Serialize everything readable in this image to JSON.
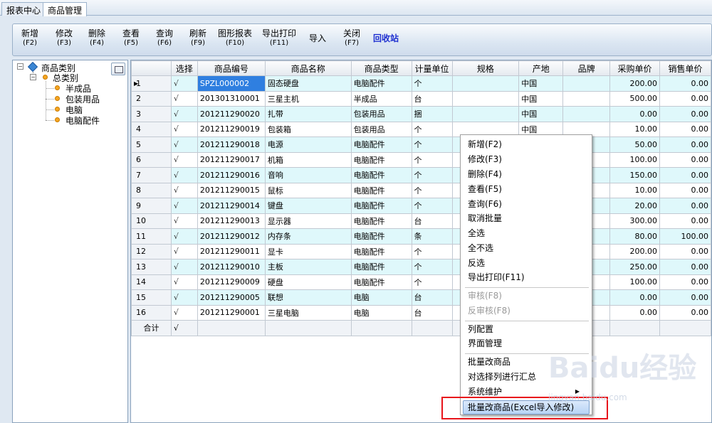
{
  "tabs": [
    "报表中心",
    "商品管理"
  ],
  "toolbar": {
    "buttons": [
      {
        "label": "新增",
        "key": "(F2)"
      },
      {
        "label": "修改",
        "key": "(F3)"
      },
      {
        "label": "删除",
        "key": "(F4)"
      },
      {
        "label": "查看",
        "key": "(F5)"
      },
      {
        "label": "查询",
        "key": "(F6)"
      },
      {
        "label": "刷新",
        "key": "(F9)"
      },
      {
        "label": "图形报表",
        "key": "(F10)"
      },
      {
        "label": "导出打印",
        "key": "(F11)"
      },
      {
        "label": "导入",
        "key": ""
      },
      {
        "label": "关闭",
        "key": "(F7)"
      },
      {
        "label": "回收站",
        "key": ""
      }
    ]
  },
  "tree": {
    "root": "商品类别",
    "group": "总类别",
    "children": [
      "半成品",
      "包装用品",
      "电脑",
      "电脑配件"
    ]
  },
  "grid": {
    "columns": [
      "选择",
      "商品编号",
      "商品名称",
      "商品类型",
      "计量单位",
      "规格",
      "产地",
      "品牌",
      "采购单价",
      "销售单价"
    ],
    "rows": [
      [
        "1",
        "√",
        "SPZL000002",
        "固态硬盘",
        "电脑配件",
        "个",
        "",
        "中国",
        "",
        "200.00",
        "0.00"
      ],
      [
        "2",
        "√",
        "201301310001",
        "三星主机",
        "半成品",
        "台",
        "",
        "中国",
        "",
        "500.00",
        "0.00"
      ],
      [
        "3",
        "√",
        "201211290020",
        "扎带",
        "包装用品",
        "捆",
        "",
        "中国",
        "",
        "0.00",
        "0.00"
      ],
      [
        "4",
        "√",
        "201211290019",
        "包装箱",
        "包装用品",
        "个",
        "",
        "中国",
        "",
        "10.00",
        "0.00"
      ],
      [
        "5",
        "√",
        "201211290018",
        "电源",
        "电脑配件",
        "个",
        "",
        "",
        "",
        "50.00",
        "0.00"
      ],
      [
        "6",
        "√",
        "201211290017",
        "机箱",
        "电脑配件",
        "个",
        "",
        "",
        "",
        "100.00",
        "0.00"
      ],
      [
        "7",
        "√",
        "201211290016",
        "音响",
        "电脑配件",
        "个",
        "",
        "",
        "",
        "150.00",
        "0.00"
      ],
      [
        "8",
        "√",
        "201211290015",
        "鼠标",
        "电脑配件",
        "个",
        "",
        "",
        "",
        "10.00",
        "0.00"
      ],
      [
        "9",
        "√",
        "201211290014",
        "键盘",
        "电脑配件",
        "个",
        "",
        "",
        "",
        "20.00",
        "0.00"
      ],
      [
        "10",
        "√",
        "201211290013",
        "显示器",
        "电脑配件",
        "台",
        "",
        "",
        "",
        "300.00",
        "0.00"
      ],
      [
        "11",
        "√",
        "201211290012",
        "内存条",
        "电脑配件",
        "条",
        "",
        "",
        "",
        "80.00",
        "100.00"
      ],
      [
        "12",
        "√",
        "201211290011",
        "显卡",
        "电脑配件",
        "个",
        "",
        "",
        "",
        "200.00",
        "0.00"
      ],
      [
        "13",
        "√",
        "201211290010",
        "主板",
        "电脑配件",
        "个",
        "",
        "",
        "",
        "250.00",
        "0.00"
      ],
      [
        "14",
        "√",
        "201211290009",
        "硬盘",
        "电脑配件",
        "个",
        "",
        "",
        "",
        "100.00",
        "0.00"
      ],
      [
        "15",
        "√",
        "201211290005",
        "联想",
        "电脑",
        "台",
        "",
        "",
        "",
        "0.00",
        "0.00"
      ],
      [
        "16",
        "√",
        "201211290001",
        "三星电脑",
        "电脑",
        "台",
        "",
        "",
        "",
        "0.00",
        "0.00"
      ]
    ],
    "total_label": "合计",
    "total_check": "√"
  },
  "context_menu": {
    "items": [
      {
        "label": "新增(F2)",
        "disabled": false
      },
      {
        "label": "修改(F3)",
        "disabled": false
      },
      {
        "label": "删除(F4)",
        "disabled": false
      },
      {
        "label": "查看(F5)",
        "disabled": false
      },
      {
        "label": "查询(F6)",
        "disabled": false
      },
      {
        "label": "取消批量",
        "disabled": false
      },
      {
        "label": "全选",
        "disabled": false
      },
      {
        "label": "全不选",
        "disabled": false
      },
      {
        "label": "反选",
        "disabled": false
      },
      {
        "label": "导出打印(F11)",
        "disabled": false
      },
      {
        "label": "审核(F8)",
        "disabled": true
      },
      {
        "label": "反审核(F8)",
        "disabled": true
      },
      {
        "label": "列配置",
        "disabled": false
      },
      {
        "label": "界面管理",
        "disabled": false
      },
      {
        "label": "批量改商品",
        "disabled": false
      },
      {
        "label": "对选择列进行汇总",
        "disabled": false
      },
      {
        "label": "系统维护",
        "disabled": false
      },
      {
        "label": "批量改商品(Excel导入修改)",
        "disabled": false
      }
    ]
  },
  "watermark": {
    "brand": "Baidu经验",
    "url": "jingyan.baidu.com"
  },
  "colors": {
    "highlight": "#2f7fe0",
    "odd_row": "#dff8fb",
    "recycle": "#1e2fd0",
    "annotation_box": "#e8141b"
  }
}
